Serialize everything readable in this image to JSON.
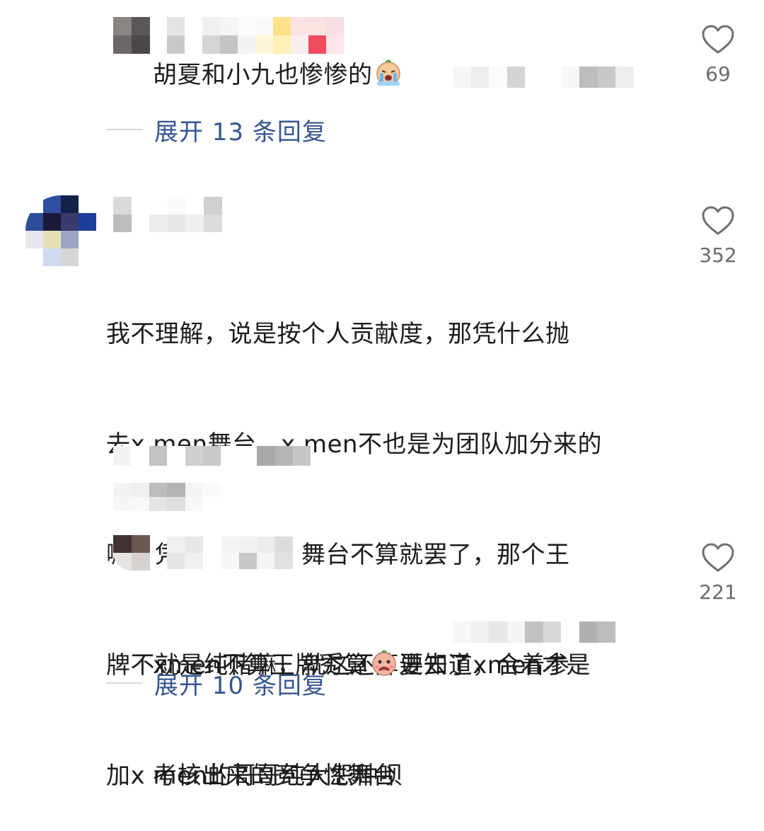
{
  "comments": [
    {
      "text": "胡夏和小九也惨惨的",
      "likes": "69",
      "expand": "展开 13 条回复"
    },
    {
      "lines": [
        "我不理解，说是按个人贡献度，那凭什么抛",
        "去x men舞台，x men不也是为团队加分来的",
        "嘛，凭什么不算，舞台不算就罢了，那个王",
        "牌不就是纯赌嘛，就这还算进去了，合着参",
        "加x men的哥哥纯大怨种呗"
      ],
      "likes": "352"
    },
    {
      "line1_a": "xmen不算王牌秀算",
      "line1_b": "要知道xmen才是",
      "line2": "考核出来的竞争性舞台",
      "likes": "221",
      "expand": "展开 10 条回复"
    }
  ],
  "icons": {
    "like": "heart-outline-icon",
    "crying_emoji": "crying-face-emoji",
    "sad_emoji": "sad-face-emoji"
  },
  "colors": {
    "link": "#36558f",
    "text": "#1c1c1c",
    "meta": "#6b6b6b"
  }
}
